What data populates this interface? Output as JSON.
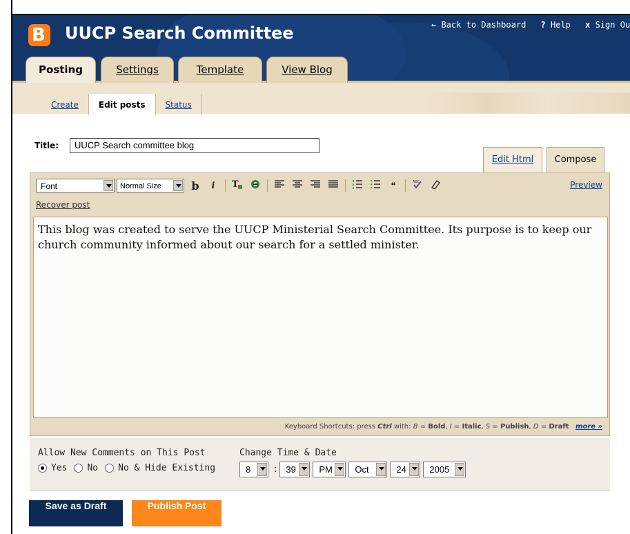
{
  "header": {
    "logo_letter": "B",
    "blog_title": "UUCP Search Committee",
    "links": [
      {
        "icon": "arrow-left-icon",
        "glyph": "←",
        "label": "Back to Dashboard"
      },
      {
        "icon": "help-icon",
        "glyph": "?",
        "label": "Help"
      },
      {
        "icon": "close-icon",
        "glyph": "x",
        "label": "Sign Out"
      }
    ]
  },
  "tabs": [
    {
      "label": "Posting",
      "active": true
    },
    {
      "label": "Settings",
      "active": false
    },
    {
      "label": "Template",
      "active": false
    },
    {
      "label": "View Blog",
      "active": false
    }
  ],
  "subnav": [
    {
      "label": "Create",
      "current": false
    },
    {
      "label": "Edit posts",
      "current": true
    },
    {
      "label": "Status",
      "current": false
    }
  ],
  "post": {
    "title_label": "Title:",
    "title_value": "UUCP Search committee blog",
    "body": "This blog was created to serve the UUCP Ministerial Search Committee. Its purpose is to keep our church community informed about our search for a settled minister."
  },
  "editor": {
    "mode_tabs": {
      "html": "Edit Html",
      "compose": "Compose"
    },
    "font_select": "Font",
    "size_select": "Normal Size",
    "toolbar_icons": [
      "bold-icon",
      "italic-icon",
      "text-color-icon",
      "link-icon",
      "align-left-icon",
      "align-center-icon",
      "align-right-icon",
      "justify-icon",
      "numbered-list-icon",
      "bullet-list-icon",
      "blockquote-icon",
      "spellcheck-icon",
      "remove-formatting-icon"
    ],
    "preview_label": "Preview",
    "recover_label": "Recover post",
    "shortcuts": {
      "prefix": "Keyboard Shortcuts: press",
      "ctrl": "Ctrl",
      "with": "with:",
      "items": [
        {
          "key": "B",
          "label": "Bold"
        },
        {
          "key": "I",
          "label": "Italic"
        },
        {
          "key": "S",
          "label": "Publish"
        },
        {
          "key": "D",
          "label": "Draft"
        }
      ],
      "more": "more »"
    }
  },
  "options": {
    "comments_label": "Allow New Comments on This Post",
    "comments_choices": [
      {
        "label": "Yes",
        "selected": true
      },
      {
        "label": "No",
        "selected": false
      },
      {
        "label": "No & Hide Existing",
        "selected": false
      }
    ],
    "date_label": "Change Time & Date",
    "hour": "8",
    "minute": "39",
    "ampm": "PM",
    "month": "Oct",
    "day": "24",
    "year": "2005"
  },
  "buttons": {
    "save_draft": "Save as Draft",
    "publish": "Publish Post"
  }
}
